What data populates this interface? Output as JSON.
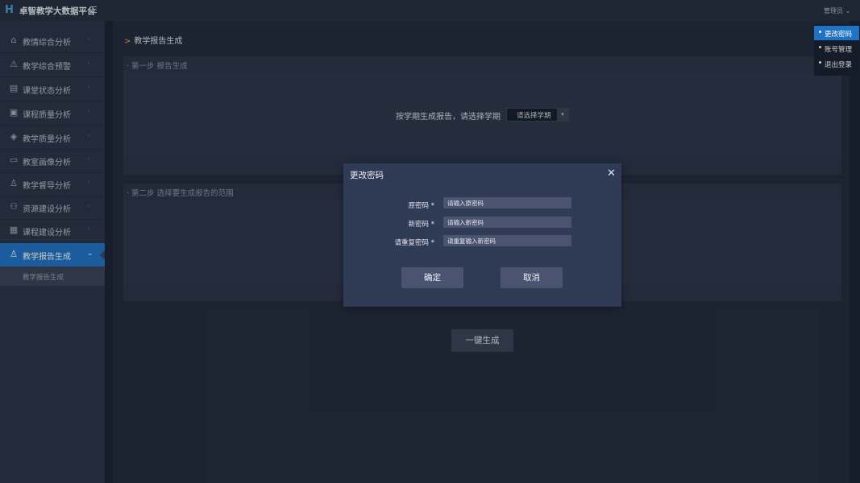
{
  "app": {
    "title": "卓智教学大数据平台",
    "logo_icon": "h-logo-icon"
  },
  "topbar": {
    "user_label": "管理员",
    "chevron": "⌄"
  },
  "sidebar": {
    "items": [
      {
        "label": "教情综合分析",
        "icon": "graduation-cap-icon",
        "glyph": "⌂"
      },
      {
        "label": "教学综合预警",
        "icon": "alarm-icon",
        "glyph": "⚠"
      },
      {
        "label": "课堂状态分析",
        "icon": "classroom-icon",
        "glyph": "▤"
      },
      {
        "label": "课程质量分析",
        "icon": "course-icon",
        "glyph": "▣"
      },
      {
        "label": "教学质量分析",
        "icon": "shield-icon",
        "glyph": "◈"
      },
      {
        "label": "教室画像分析",
        "icon": "monitor-icon",
        "glyph": "▭"
      },
      {
        "label": "教学督导分析",
        "icon": "supervisor-icon",
        "glyph": "♙"
      },
      {
        "label": "资源建设分析",
        "icon": "resource-icon",
        "glyph": "⚇"
      },
      {
        "label": "课程建设分析",
        "icon": "clipboard-icon",
        "glyph": "▦"
      },
      {
        "label": "教学报告生成",
        "icon": "report-icon",
        "glyph": "♙"
      }
    ],
    "sub_item": "教学报告生成"
  },
  "breadcrumb": {
    "caret": ">",
    "label": "教学报告生成"
  },
  "step1": {
    "title": "第一步  报告生成",
    "prompt": "按学期生成报告，请选择学期",
    "select_value": "请选择学期"
  },
  "step2": {
    "title": "第二步  选择要生成报告的范围"
  },
  "generate_button": "一键生成",
  "dropdown": {
    "items": [
      "更改密码",
      "账号管理",
      "退出登录"
    ]
  },
  "modal": {
    "title": "更改密码",
    "fields": [
      {
        "label": "原密码 *",
        "placeholder": "请输入原密码"
      },
      {
        "label": "新密码 *",
        "placeholder": "请输入新密码"
      },
      {
        "label": "请重复密码 *",
        "placeholder": "请重复输入新密码"
      }
    ],
    "confirm": "确定",
    "cancel": "取消"
  },
  "colors": {
    "accent": "#1f72c4",
    "sidebar": "#2b3446",
    "modal": "#2f3a55",
    "breadcrumb_caret": "#e9a93a"
  }
}
